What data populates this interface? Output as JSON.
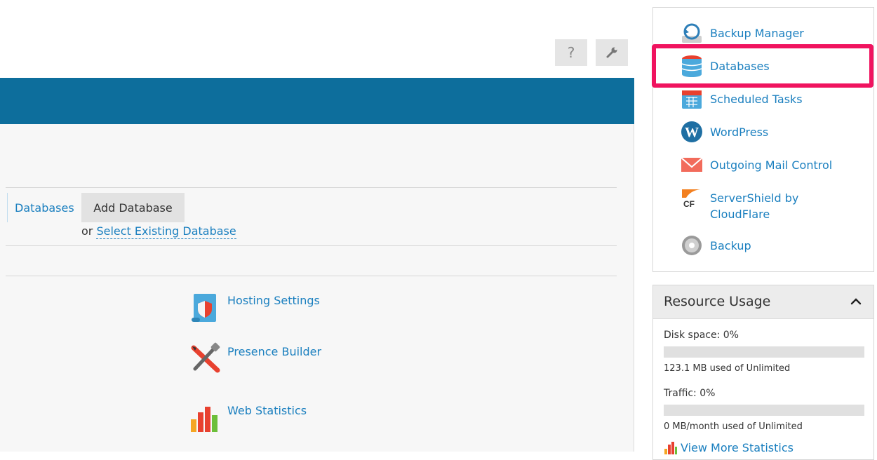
{
  "toolbar": {
    "help_label": "?",
    "settings_icon": "wrench-icon"
  },
  "databases_section": {
    "tab_label": "Databases",
    "add_button_label": "Add Database",
    "or_text": "or",
    "select_existing_label": "Select Existing Database"
  },
  "features": [
    {
      "label": "Hosting Settings",
      "icon": "hosting-settings-icon"
    },
    {
      "label": "Presence Builder",
      "icon": "presence-builder-icon"
    },
    {
      "label": "Web Statistics",
      "icon": "web-statistics-icon"
    }
  ],
  "sidebar": {
    "items": [
      {
        "label": "Backup Manager",
        "icon": "backup-manager-icon"
      },
      {
        "label": "Databases",
        "icon": "databases-icon"
      },
      {
        "label": "Scheduled Tasks",
        "icon": "scheduled-tasks-icon"
      },
      {
        "label": "WordPress",
        "icon": "wordpress-icon"
      },
      {
        "label": "Outgoing Mail Control",
        "icon": "mail-icon"
      },
      {
        "label": "ServerShield by CloudFlare",
        "icon": "cloudflare-icon"
      },
      {
        "label": "Backup",
        "icon": "backup-disc-icon"
      }
    ],
    "highlight_color": "#f0135f"
  },
  "resource_usage": {
    "title": "Resource Usage",
    "disk_label": "Disk space: 0%",
    "disk_percent": 0,
    "disk_note": "123.1 MB used of Unlimited",
    "traffic_label": "Traffic: 0%",
    "traffic_percent": 0,
    "traffic_note": "0 MB/month used of Unlimited",
    "more_stats_label": "View More Statistics"
  },
  "colors": {
    "accent": "#0d6e9c",
    "link": "#1a7fbf"
  }
}
